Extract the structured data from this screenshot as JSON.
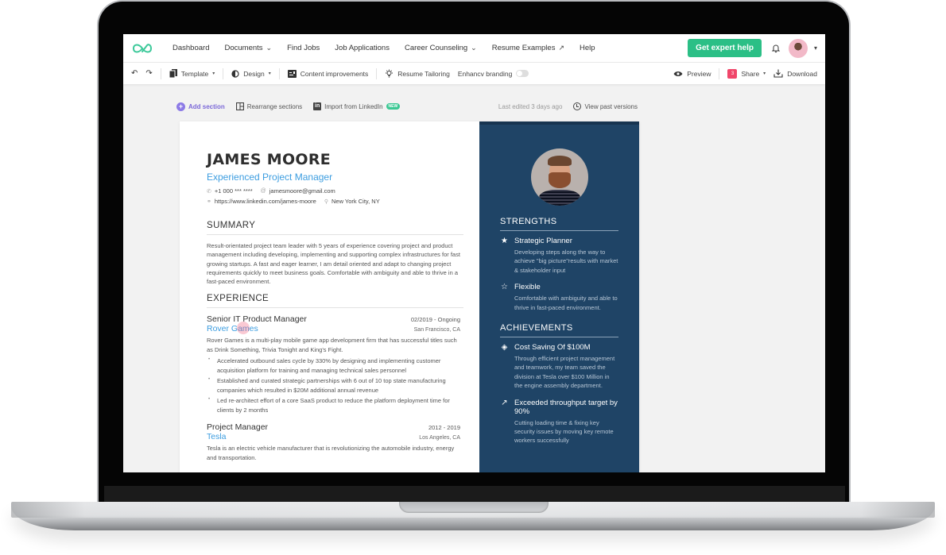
{
  "nav": {
    "items": [
      {
        "label": "Dashboard",
        "has_chevron": false
      },
      {
        "label": "Documents",
        "has_chevron": true
      },
      {
        "label": "Find Jobs",
        "has_chevron": false
      },
      {
        "label": "Job Applications",
        "has_chevron": false
      },
      {
        "label": "Career Counseling",
        "has_chevron": true
      },
      {
        "label": "Resume Examples",
        "has_chevron": false,
        "external": true
      },
      {
        "label": "Help",
        "has_chevron": false
      }
    ],
    "expert_button": "Get expert help",
    "chevron_glyph": "⌄",
    "external_glyph": "↗",
    "caret_glyph": "▾"
  },
  "toolbar": {
    "undo_glyph": "↶",
    "redo_glyph": "↷",
    "template_label": "Template",
    "design_label": "Design",
    "content_label": "Content improvements",
    "tailoring_label": "Resume Tailoring",
    "branding_label": "Enhancv branding",
    "branding_enabled": false,
    "preview_label": "Preview",
    "share_label": "Share",
    "share_badge": "3",
    "download_label": "Download"
  },
  "actions": {
    "add_section": "Add section",
    "rearrange": "Rearrange sections",
    "import_linkedin": "Import from LinkedIn",
    "new_badge": "NEW",
    "last_edited": "Last edited 3 days ago",
    "view_versions": "View past versions"
  },
  "resume": {
    "name": "JAMES MOORE",
    "title": "Experienced Project Manager",
    "phone": "+1 000 *** ****",
    "email": "jamesmoore@gmail.com",
    "linkedin": "https://www.linkedin.com/james-moore",
    "location": "New York City, NY",
    "summary_heading": "SUMMARY",
    "summary": "Result-orientated project team leader with 5 years of experience covering project and product management including developing, implementing and supporting complex infrastructures for fast growing startups. A fast and eager learner, I am detail oriented and adapt to changing project requirements quickly to meet business goals. Comfortable with ambiguity and able to thrive in a fast-paced environment.",
    "experience_heading": "EXPERIENCE",
    "jobs": [
      {
        "title": "Senior IT Product Manager",
        "dates": "02/2019 - Ongoing",
        "company": "Rover Games",
        "location": "San Francisco, CA",
        "description": "Rover Games is a multi-play mobile game app development firm that has successful titles such as Drink Something, Trivia Tonight and King's Fight.",
        "bullets": [
          "Accelerated outbound sales cycle by 330% by designing and implementing customer acquisition platform for training and managing technical sales personnel",
          "Established and curated strategic partnerships with 6 out of 10 top state manufacturing companies which resulted in $20M additional annual revenue",
          "Led re-architect effort of a core SaaS product to reduce the platform deployment time for clients by 2 months"
        ]
      },
      {
        "title": "Project Manager",
        "dates": "2012 - 2019",
        "company": "Tesla",
        "location": "Los Angeles, CA",
        "description": "Tesla is an electric vehicle manufacturer that is revolutionizing the automobile industry, energy and transportation."
      }
    ],
    "strengths_heading": "STRENGTHS",
    "strengths": [
      {
        "icon": "★",
        "title": "Strategic Planner",
        "description": "Developing steps along the way to achieve \"big picture\"results with market & stakeholder input"
      },
      {
        "icon": "☆",
        "title": "Flexible",
        "description": "Comfortable with ambiguity and able to thrive in fast-paced environment."
      }
    ],
    "achievements_heading": "ACHIEVEMENTS",
    "achievements": [
      {
        "icon": "◈",
        "title": "Cost Saving Of $100M",
        "description": "Through efficient project management and teamwork, my team saved the division at Tesla over $100 Million in the engine assembly department."
      },
      {
        "icon": "↗",
        "title": "Exceeded throughput target by 90%",
        "description": "Cutting loading time & fixing key security issues by moving key remote workers successfully"
      }
    ]
  },
  "colors": {
    "brand_green": "#2bbf86",
    "accent_blue": "#3c9de0",
    "sidebar_navy": "#1f4466",
    "add_section_purple": "#7b68d8",
    "share_badge_pink": "#f0466a"
  }
}
